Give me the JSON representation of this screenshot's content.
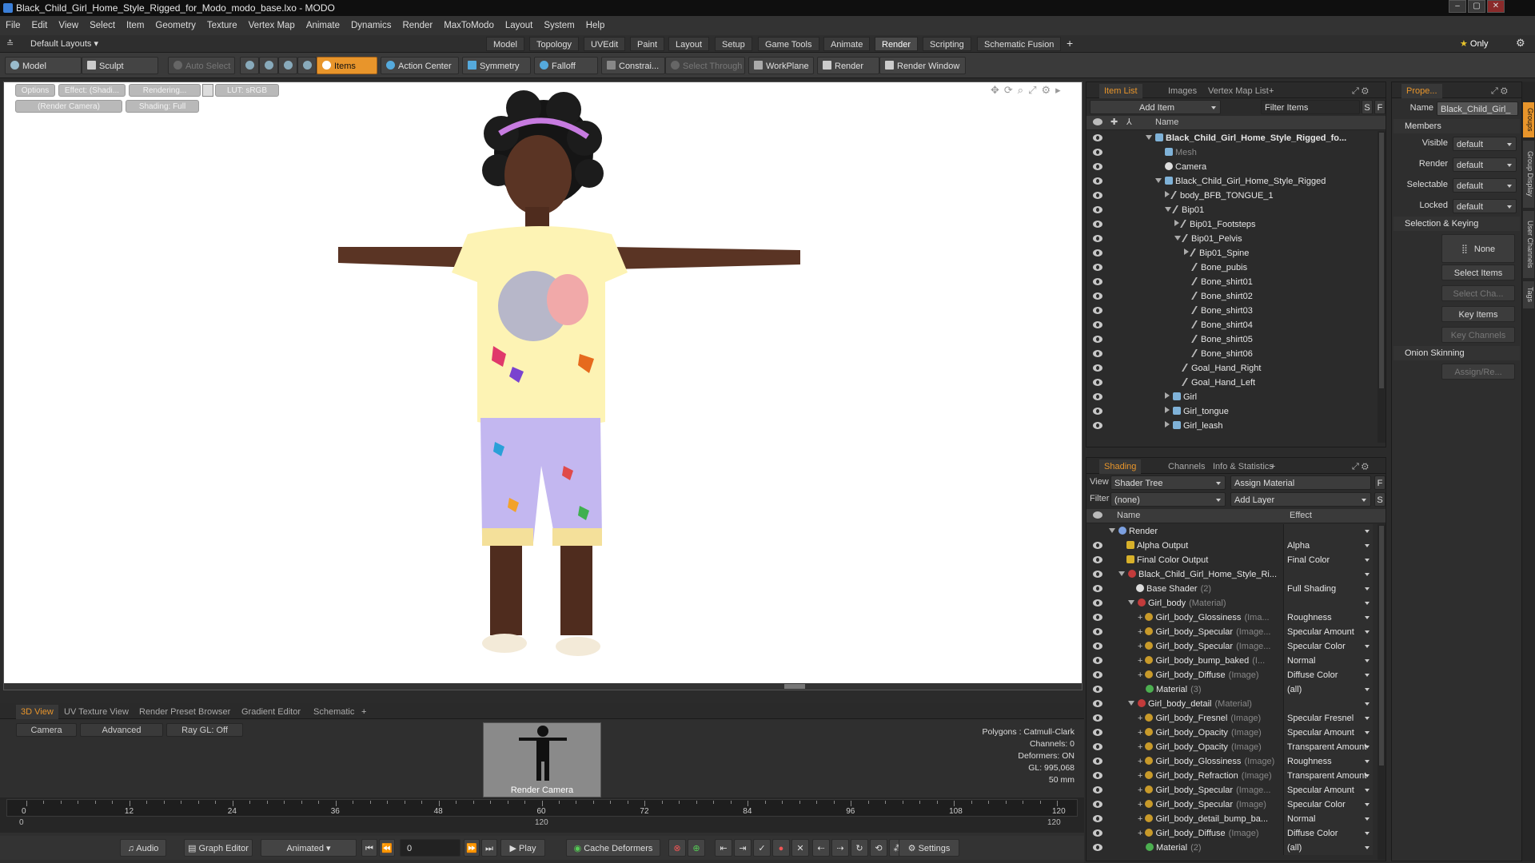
{
  "window": {
    "title": "Black_Child_Girl_Home_Style_Rigged_for_Modo_modo_base.lxo - MODO"
  },
  "menu": [
    "File",
    "Edit",
    "View",
    "Select",
    "Item",
    "Geometry",
    "Texture",
    "Vertex Map",
    "Animate",
    "Dynamics",
    "Render",
    "MaxToModo",
    "Layout",
    "System",
    "Help"
  ],
  "layout": {
    "preset": "Default Layouts",
    "tabs": [
      "Model",
      "Topology",
      "UVEdit",
      "Paint",
      "Layout",
      "Setup",
      "Game Tools",
      "Animate",
      "Render",
      "Scripting",
      "Schematic Fusion"
    ],
    "active_tab": "Render",
    "only_label": "Only"
  },
  "toolbar": {
    "model": "Model",
    "sculpt": "Sculpt",
    "auto_select": "Auto Select",
    "items": "Items",
    "action_center": "Action Center",
    "symmetry": "Symmetry",
    "falloff": "Falloff",
    "constrain": "Constrai...",
    "select_through": "Select Through",
    "workplane": "WorkPlane",
    "render": "Render",
    "render_window": "Render Window"
  },
  "viewport": {
    "options": "Options",
    "effect": "Effect: (Shadi...",
    "rendering": "Rendering...",
    "lut": "LUT: sRGB",
    "camera": "(Render Camera)",
    "shading": "Shading: Full"
  },
  "bottom": {
    "tabs": [
      "3D View",
      "UV Texture View",
      "Render Preset Browser",
      "Gradient Editor",
      "Schematic"
    ],
    "buttons": {
      "camera": "Camera",
      "advanced": "Advanced",
      "raygl": "Ray GL: Off"
    },
    "preview_label": "Render Camera",
    "stats": [
      "Polygons : Catmull-Clark",
      "Channels: 0",
      "Deformers: ON",
      "GL: 995,068",
      "50 mm"
    ],
    "timeline_ticks": [
      "0",
      "12",
      "24",
      "36",
      "48",
      "60",
      "72",
      "84",
      "96",
      "108",
      "120"
    ],
    "timeline_sub": [
      "0",
      "120",
      "120"
    ]
  },
  "transport": {
    "audio": "Audio",
    "graph_editor": "Graph Editor",
    "animated": "Animated",
    "frame": "0",
    "play": "Play",
    "cache": "Cache Deformers",
    "settings": "Settings"
  },
  "item_list": {
    "tabs": [
      "Item List",
      "Images",
      "Vertex Map List"
    ],
    "add_item": "Add Item",
    "filter": "Filter Items",
    "col_name": "Name",
    "s": "S",
    "f": "F",
    "rows": [
      {
        "label": "Black_Child_Girl_Home_Style_Rigged_fo...",
        "indent": 0,
        "icon": "mesh",
        "tri": "d",
        "bold": true
      },
      {
        "label": "Mesh",
        "indent": 1,
        "icon": "mesh",
        "tri": "",
        "dim": true
      },
      {
        "label": "Camera",
        "indent": 1,
        "icon": "cam",
        "tri": ""
      },
      {
        "label": "Black_Child_Girl_Home_Style_Rigged",
        "indent": 1,
        "icon": "mesh",
        "tri": "d"
      },
      {
        "label": "body_BFB_TONGUE_1",
        "indent": 2,
        "icon": "bone",
        "tri": "r"
      },
      {
        "label": "Bip01",
        "indent": 2,
        "icon": "bone",
        "tri": "d"
      },
      {
        "label": "Bip01_Footsteps",
        "indent": 3,
        "icon": "bone",
        "tri": "r"
      },
      {
        "label": "Bip01_Pelvis",
        "indent": 3,
        "icon": "bone",
        "tri": "d"
      },
      {
        "label": "Bip01_Spine",
        "indent": 4,
        "icon": "bone",
        "tri": "r"
      },
      {
        "label": "Bone_pubis",
        "indent": 4,
        "icon": "bone",
        "tri": ""
      },
      {
        "label": "Bone_shirt01",
        "indent": 4,
        "icon": "bone",
        "tri": ""
      },
      {
        "label": "Bone_shirt02",
        "indent": 4,
        "icon": "bone",
        "tri": ""
      },
      {
        "label": "Bone_shirt03",
        "indent": 4,
        "icon": "bone",
        "tri": ""
      },
      {
        "label": "Bone_shirt04",
        "indent": 4,
        "icon": "bone",
        "tri": ""
      },
      {
        "label": "Bone_shirt05",
        "indent": 4,
        "icon": "bone",
        "tri": ""
      },
      {
        "label": "Bone_shirt06",
        "indent": 4,
        "icon": "bone",
        "tri": ""
      },
      {
        "label": "Goal_Hand_Right",
        "indent": 3,
        "icon": "bone",
        "tri": ""
      },
      {
        "label": "Goal_Hand_Left",
        "indent": 3,
        "icon": "bone",
        "tri": ""
      },
      {
        "label": "Girl",
        "indent": 2,
        "icon": "mesh",
        "tri": "r"
      },
      {
        "label": "Girl_tongue",
        "indent": 2,
        "icon": "mesh",
        "tri": "r"
      },
      {
        "label": "Girl_leash",
        "indent": 2,
        "icon": "mesh",
        "tri": "r"
      }
    ]
  },
  "shading": {
    "tabs": [
      "Shading",
      "Channels",
      "Info & Statistics"
    ],
    "view_label": "View",
    "view_value": "Shader Tree",
    "assign": "Assign Material",
    "filter_label": "Filter",
    "filter_value": "(none)",
    "add_layer": "Add Layer",
    "col_name": "Name",
    "col_effect": "Effect",
    "f": "F",
    "s": "S",
    "rows": [
      {
        "label": "Render",
        "sub": "",
        "effect": "",
        "indent": 0,
        "icon": "rend",
        "tri": "d"
      },
      {
        "label": "Alpha Output",
        "sub": "",
        "effect": "Alpha",
        "indent": 1,
        "icon": "out",
        "tri": ""
      },
      {
        "label": "Final Color Output",
        "sub": "",
        "effect": "Final Color",
        "indent": 1,
        "icon": "out",
        "tri": ""
      },
      {
        "label": "Black_Child_Girl_Home_Style_Ri...",
        "sub": "",
        "effect": "",
        "indent": 1,
        "icon": "mat",
        "tri": "d"
      },
      {
        "label": "Base Shader",
        "sub": "(2)",
        "effect": "Full Shading",
        "indent": 2,
        "icon": "shader",
        "tri": ""
      },
      {
        "label": "Girl_body",
        "sub": "(Material)",
        "effect": "",
        "indent": 2,
        "icon": "mat",
        "tri": "d"
      },
      {
        "label": "Girl_body_Glossiness",
        "sub": "(Ima...",
        "effect": "Roughness",
        "indent": 3,
        "icon": "img",
        "tri": "+"
      },
      {
        "label": "Girl_body_Specular",
        "sub": "(Image...",
        "effect": "Specular Amount",
        "indent": 3,
        "icon": "img",
        "tri": "+"
      },
      {
        "label": "Girl_body_Specular",
        "sub": "(Image...",
        "effect": "Specular Color",
        "indent": 3,
        "icon": "img",
        "tri": "+"
      },
      {
        "label": "Girl_body_bump_baked",
        "sub": "(I...",
        "effect": "Normal",
        "indent": 3,
        "icon": "img",
        "tri": "+"
      },
      {
        "label": "Girl_body_Diffuse",
        "sub": "(Image)",
        "effect": "Diffuse Color",
        "indent": 3,
        "icon": "img",
        "tri": "+"
      },
      {
        "label": "Material",
        "sub": "(3)",
        "effect": "(all)",
        "indent": 3,
        "icon": "grn",
        "tri": ""
      },
      {
        "label": "Girl_body_detail",
        "sub": "(Material)",
        "effect": "",
        "indent": 2,
        "icon": "mat",
        "tri": "d"
      },
      {
        "label": "Girl_body_Fresnel",
        "sub": "(Image)",
        "effect": "Specular Fresnel",
        "indent": 3,
        "icon": "img",
        "tri": "+"
      },
      {
        "label": "Girl_body_Opacity",
        "sub": "(Image)",
        "effect": "Specular Amount",
        "indent": 3,
        "icon": "img",
        "tri": "+"
      },
      {
        "label": "Girl_body_Opacity",
        "sub": "(Image)",
        "effect": "Transparent Amount",
        "indent": 3,
        "icon": "img",
        "tri": "+"
      },
      {
        "label": "Girl_body_Glossiness",
        "sub": "(Image)",
        "effect": "Roughness",
        "indent": 3,
        "icon": "img",
        "tri": "+"
      },
      {
        "label": "Girl_body_Refraction",
        "sub": "(Image)",
        "effect": "Transparent Amount",
        "indent": 3,
        "icon": "img",
        "tri": "+"
      },
      {
        "label": "Girl_body_Specular",
        "sub": "(Image...",
        "effect": "Specular Amount",
        "indent": 3,
        "icon": "img",
        "tri": "+"
      },
      {
        "label": "Girl_body_Specular",
        "sub": "(Image)",
        "effect": "Specular Color",
        "indent": 3,
        "icon": "img",
        "tri": "+"
      },
      {
        "label": "Girl_body_detail_bump_ba...",
        "sub": "",
        "effect": "Normal",
        "indent": 3,
        "icon": "img",
        "tri": "+"
      },
      {
        "label": "Girl_body_Diffuse",
        "sub": "(Image)",
        "effect": "Diffuse Color",
        "indent": 3,
        "icon": "img",
        "tri": "+"
      },
      {
        "label": "Material",
        "sub": "(2)",
        "effect": "(all)",
        "indent": 3,
        "icon": "grn",
        "tri": ""
      }
    ]
  },
  "properties": {
    "tab": "Prope...",
    "name_label": "Name",
    "name_value": "Black_Child_Girl_",
    "members": "Members",
    "fields": [
      {
        "label": "Visible",
        "value": "default"
      },
      {
        "label": "Render",
        "value": "default"
      },
      {
        "label": "Selectable",
        "value": "default"
      },
      {
        "label": "Locked",
        "value": "default"
      }
    ],
    "selection_keying": "Selection & Keying",
    "none_btn": "None",
    "select_items": "Select Items",
    "select_channels": "Select Cha...",
    "key_items": "Key Items",
    "key_channels": "Key Channels",
    "onion": "Onion Skinning",
    "assign_remove": "Assign/Re..."
  },
  "side_tabs": [
    "Groups",
    "Group Display",
    "User Channels",
    "Tags"
  ],
  "colors": {
    "accent": "#e8952b",
    "viewport_bg": "#ffffff",
    "panel_bg": "#2b2b2b"
  }
}
